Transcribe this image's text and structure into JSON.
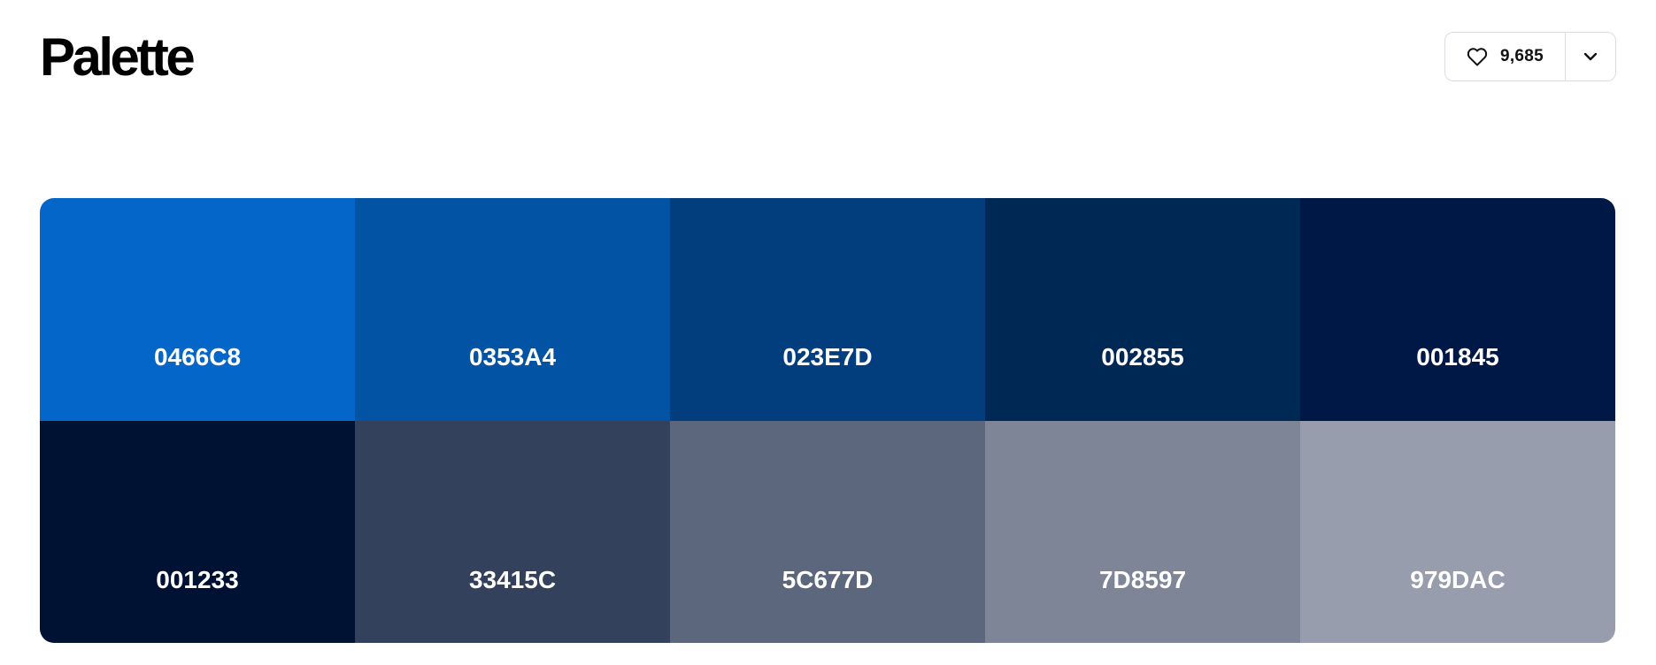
{
  "header": {
    "title": "Palette",
    "like_count": "9,685",
    "like_icon": "heart-icon",
    "dropdown_icon": "chevron-down-icon"
  },
  "colors": {
    "border": "#dcdde2",
    "text_on_swatch": "#ffffff"
  },
  "palette": {
    "swatches": [
      {
        "hex": "0466C8",
        "color": "#0466C8"
      },
      {
        "hex": "0353A4",
        "color": "#0353A4"
      },
      {
        "hex": "023E7D",
        "color": "#023E7D"
      },
      {
        "hex": "002855",
        "color": "#002855"
      },
      {
        "hex": "001845",
        "color": "#001845"
      },
      {
        "hex": "001233",
        "color": "#001233"
      },
      {
        "hex": "33415C",
        "color": "#33415C"
      },
      {
        "hex": "5C677D",
        "color": "#5C677D"
      },
      {
        "hex": "7D8597",
        "color": "#7D8597"
      },
      {
        "hex": "979DAC",
        "color": "#979DAC"
      }
    ]
  }
}
